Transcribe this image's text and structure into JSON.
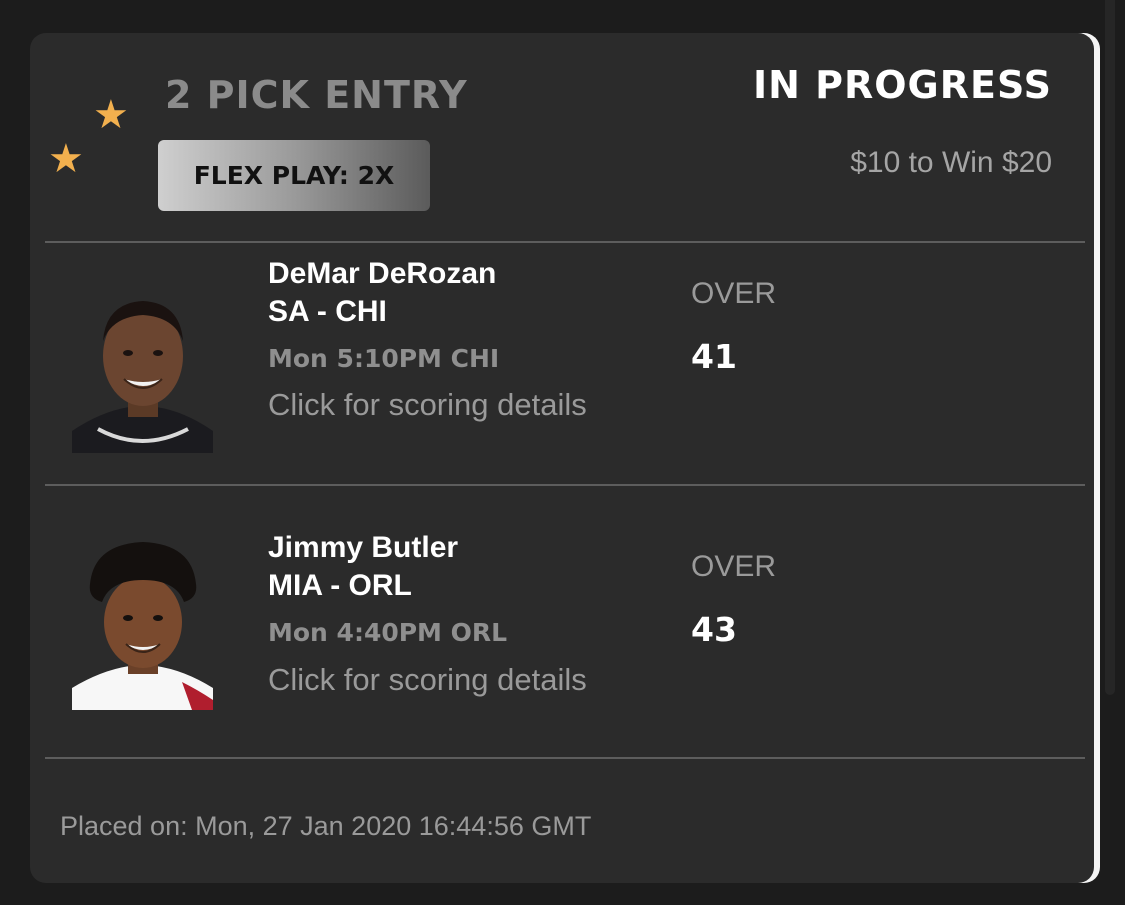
{
  "entry": {
    "title": "2 PICK ENTRY",
    "badge": "FLEX PLAY: 2X",
    "status": "IN PROGRESS",
    "stake": "$10 to Win $20",
    "placed_on": "Placed on: Mon, 27 Jan 2020 16:44:56 GMT"
  },
  "picks": [
    {
      "player": "DeMar DeRozan",
      "matchup": "SA - CHI",
      "gametime": "Mon  5:10PM CHI",
      "link": "Click for scoring details",
      "direction": "OVER",
      "line": "41",
      "jersey_color": "#1b1b1f"
    },
    {
      "player": "Jimmy Butler",
      "matchup": "MIA - ORL",
      "gametime": "Mon  4:40PM ORL",
      "link": "Click for scoring details",
      "direction": "OVER",
      "line": "43",
      "jersey_color": "#f7f7f7"
    }
  ],
  "colors": {
    "card_bg": "#2b2b2b",
    "page_bg": "#1c1c1c",
    "star": "#f2b04e",
    "badge_gradient_start": "#cfcfcf",
    "badge_gradient_end": "#5b5b5b",
    "divider": "#5d5d5d"
  }
}
